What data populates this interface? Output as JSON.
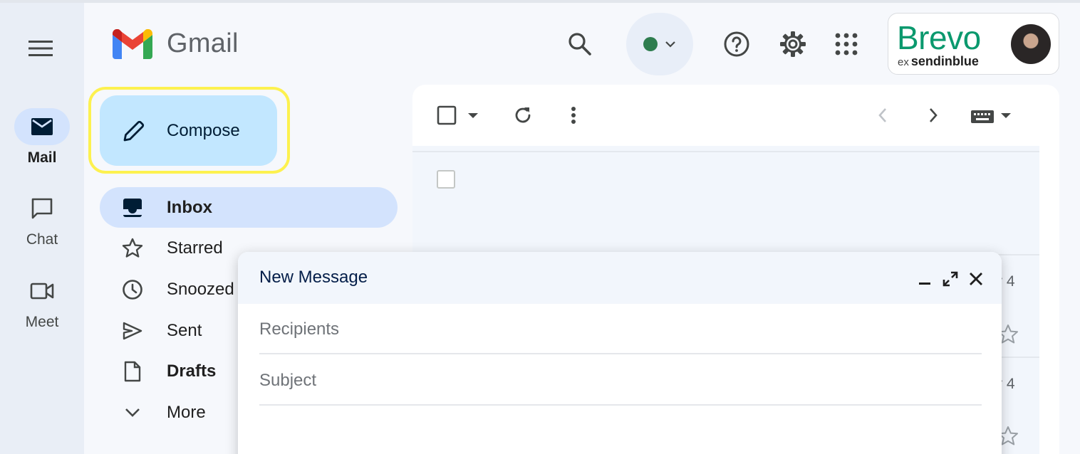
{
  "app": {
    "name": "Gmail"
  },
  "rail": {
    "items": [
      {
        "label": "Mail",
        "icon": "mail-icon",
        "active": true
      },
      {
        "label": "Chat",
        "icon": "chat-icon",
        "active": false
      },
      {
        "label": "Meet",
        "icon": "video-icon",
        "active": false
      }
    ]
  },
  "header": {
    "icons": [
      "search-icon",
      "status-dot",
      "help-icon",
      "settings-icon",
      "apps-grid-icon"
    ],
    "account": {
      "brand": "Brevo",
      "brand_prefix": "ex",
      "brand_suffix": "sendinblue"
    }
  },
  "compose": {
    "label": "Compose"
  },
  "nav": {
    "items": [
      {
        "label": "Inbox",
        "bold": true,
        "active": true
      },
      {
        "label": "Starred",
        "bold": false
      },
      {
        "label": "Snoozed",
        "bold": false
      },
      {
        "label": "Sent",
        "bold": false
      },
      {
        "label": "Drafts",
        "bold": true
      },
      {
        "label": "More",
        "bold": false
      }
    ]
  },
  "mail_list": {
    "dates": [
      "r 4",
      "r 4"
    ]
  },
  "dialog": {
    "title": "New Message",
    "recipients_placeholder": "Recipients",
    "subject_placeholder": "Subject"
  },
  "colors": {
    "accent": "#c2e7ff",
    "active_nav": "#d3e3fd",
    "highlight_ring": "#fdf14f",
    "brand_green": "#0b996e",
    "background": "#f6f8fc"
  }
}
